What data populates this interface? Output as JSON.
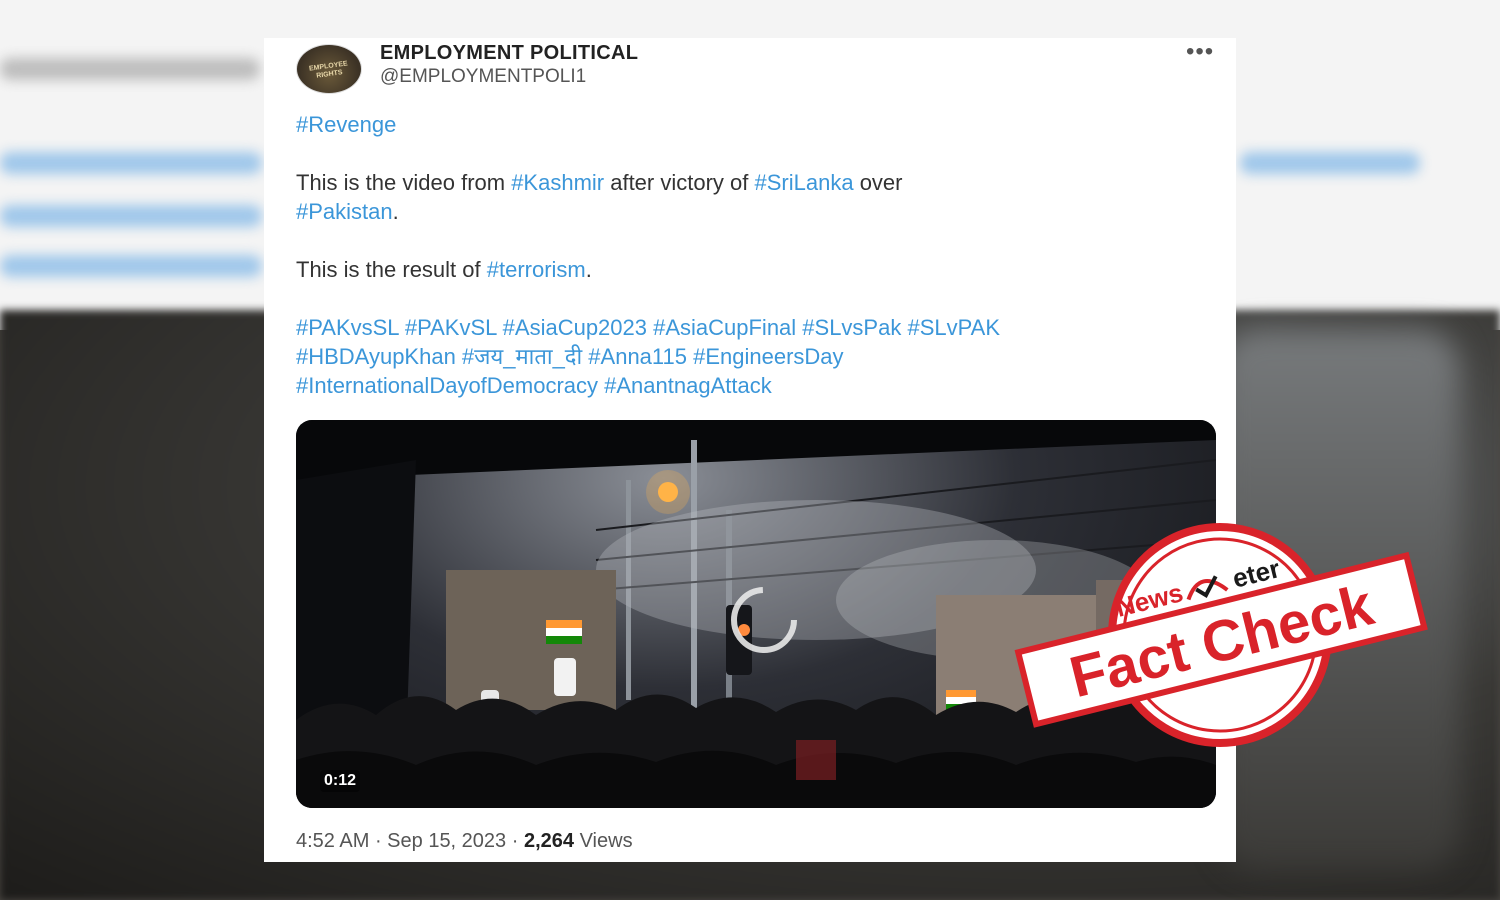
{
  "tweet": {
    "author_name": "EMPLOYMENT POLITICAL",
    "author_handle": "@EMPLOYMENTPOLI1",
    "avatar_text": "EMPLOYEE RIGHTS",
    "line1": "#Revenge",
    "line2_pre": "This is the video from ",
    "line2_tag1": "#Kashmir",
    "line2_mid": " after victory of ",
    "line2_tag2": "#SriLanka",
    "line2_post": " over",
    "line3_tag": "#Pakistan",
    "line3_post": ".",
    "line4_pre": "This is the result of ",
    "line4_tag": "#terrorism",
    "line4_post": ".",
    "hashtags_line1": "#PAKvsSL #PAKvSL #AsiaCup2023 #AsiaCupFinal #SLvsPak #SLvPAK",
    "hashtags_line2": "#HBDAyupKhan #जय_माता_दी #Anna115 #EngineersDay",
    "hashtags_line3": "#InternationalDayofDemocracy #AnantnagAttack",
    "video_duration": "0:12",
    "time": "4:52 AM",
    "date": "Sep 15, 2023",
    "views_count": "2,264",
    "views_label": "Views",
    "separator": " · "
  },
  "stamp": {
    "brand_left": "News",
    "brand_right": "eter",
    "label": "Fact Check",
    "color": "#d9232a"
  }
}
